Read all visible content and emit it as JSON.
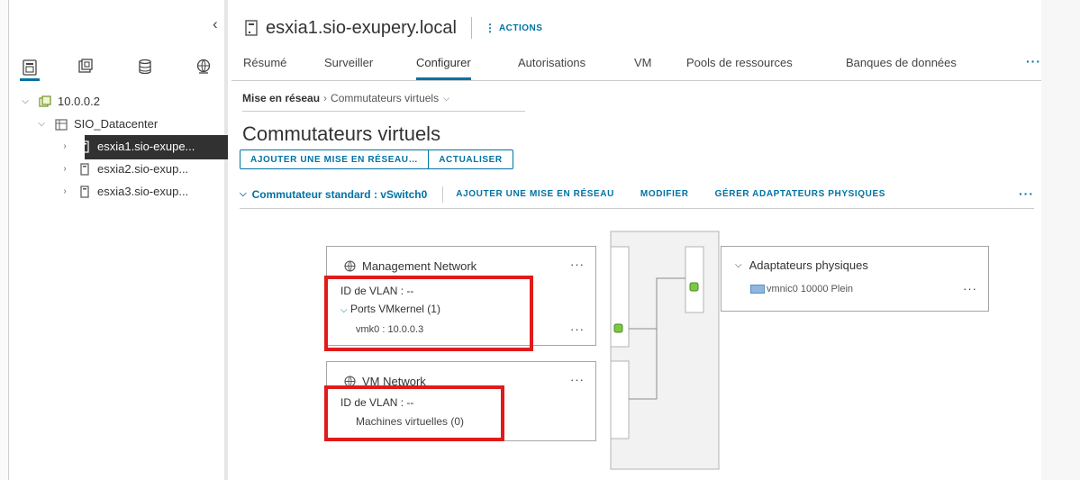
{
  "inventory": {
    "tabs": [
      {
        "name": "hosts-clusters",
        "active": true
      },
      {
        "name": "vms-templates",
        "active": false
      },
      {
        "name": "storage",
        "active": false
      },
      {
        "name": "networking",
        "active": false
      }
    ],
    "tree": [
      {
        "label": "10.0.0.2",
        "icon": "vcenter-icon",
        "expanded": true
      },
      {
        "label": "SIO_Datacenter",
        "icon": "datacenter-icon",
        "expanded": true
      },
      {
        "label": "esxia1.sio-exupe...",
        "icon": "host-icon",
        "selected": true
      },
      {
        "label": "esxia2.sio-exup...",
        "icon": "host-icon"
      },
      {
        "label": "esxia3.sio-exup...",
        "icon": "host-icon"
      }
    ]
  },
  "header": {
    "title": "esxia1.sio-exupery.local",
    "actions_label": "ACTIONS"
  },
  "tabs": [
    {
      "label": "Résumé"
    },
    {
      "label": "Surveiller"
    },
    {
      "label": "Configurer",
      "active": true
    },
    {
      "label": "Autorisations"
    },
    {
      "label": "VM"
    },
    {
      "label": "Pools de ressources"
    },
    {
      "label": "Banques de données"
    }
  ],
  "more_label": "···",
  "breadcrumb": {
    "section": "Mise en réseau",
    "separator": "›",
    "current": "Commutateurs virtuels"
  },
  "page_title": "Commutateurs virtuels",
  "toolbar": {
    "add_networking": "AJOUTER UNE MISE EN RÉSEAU…",
    "refresh": "ACTUALISER"
  },
  "switch": {
    "title": "Commutateur standard : vSwitch0",
    "actions": [
      "AJOUTER UNE MISE EN RÉSEAU",
      "MODIFIER",
      "GÉRER ADAPTATEURS PHYSIQUES"
    ]
  },
  "port_groups": [
    {
      "name": "Management Network",
      "vlan": "ID de VLAN : --",
      "ports_label": "Ports VMkernel (1)",
      "vmk": "vmk0 : 10.0.0.3"
    },
    {
      "name": "VM Network",
      "vlan": "ID de VLAN : --",
      "vms_label": "Machines virtuelles (0)"
    }
  ],
  "adapters": {
    "title": "Adaptateurs physiques",
    "nic": "vmnic0 10000 Plein"
  },
  "colors": {
    "accent": "#0072a3",
    "highlight": "#e01b1b",
    "port_green": "#7ac943"
  }
}
